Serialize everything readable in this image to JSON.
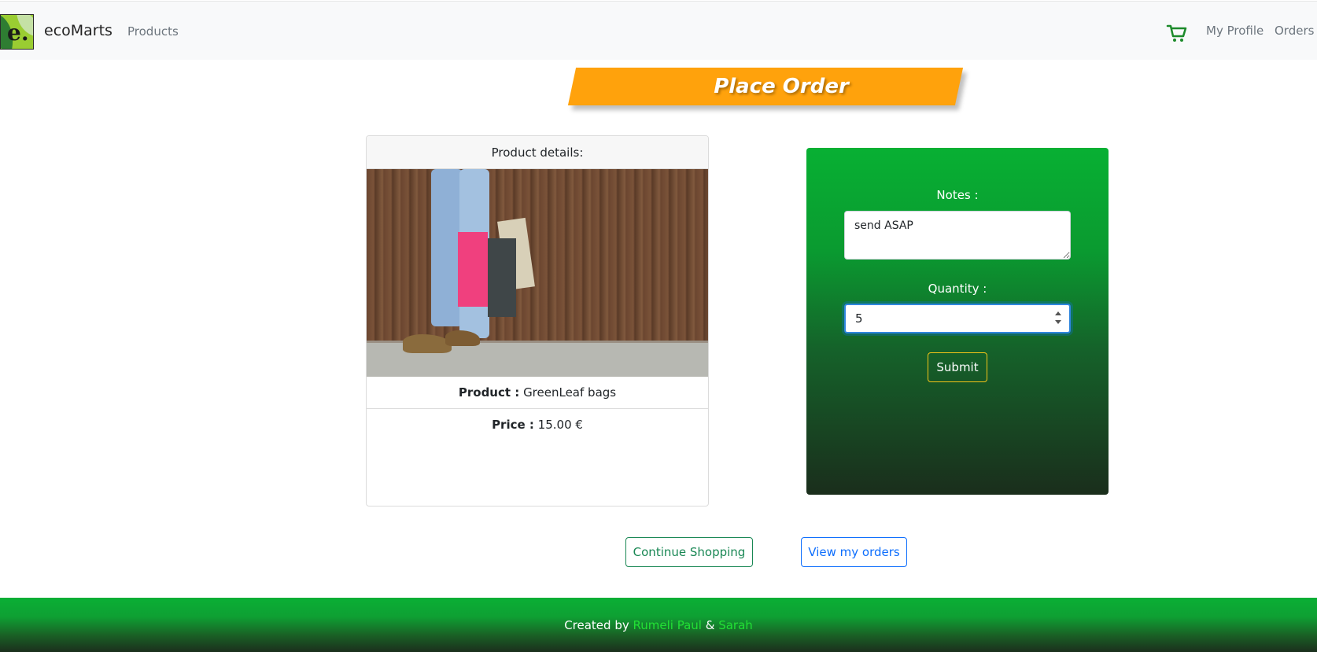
{
  "navbar": {
    "brand_letter": "e.",
    "brand_name": "ecoMarts",
    "products_link": "Products",
    "cart_icon": "shopping-cart-icon",
    "profile_link": "My Profile",
    "orders_link": "Orders"
  },
  "banner": {
    "title": "Place Order",
    "color": "#ffa20c"
  },
  "product_card": {
    "header": "Product details:",
    "image_subject": "shopping-bags-photo",
    "product_label": "Product :",
    "product_name": "GreenLeaf bags",
    "price_label": "Price :",
    "price_value": "15.00 €"
  },
  "order_form": {
    "notes_label": "Notes :",
    "notes_value": "send ASAP",
    "quantity_label": "Quantity :",
    "quantity_value": "5",
    "submit_label": "Submit"
  },
  "actions": {
    "continue_label": "Continue Shopping",
    "view_orders_label": "View my orders"
  },
  "footer": {
    "created_by": "Created by",
    "author1": "Rumeli Paul",
    "separator": "&",
    "author2": "Sarah"
  },
  "colors": {
    "accent_green": "#08b033",
    "banner_orange": "#ffa20c",
    "link_green": "#22e035"
  }
}
